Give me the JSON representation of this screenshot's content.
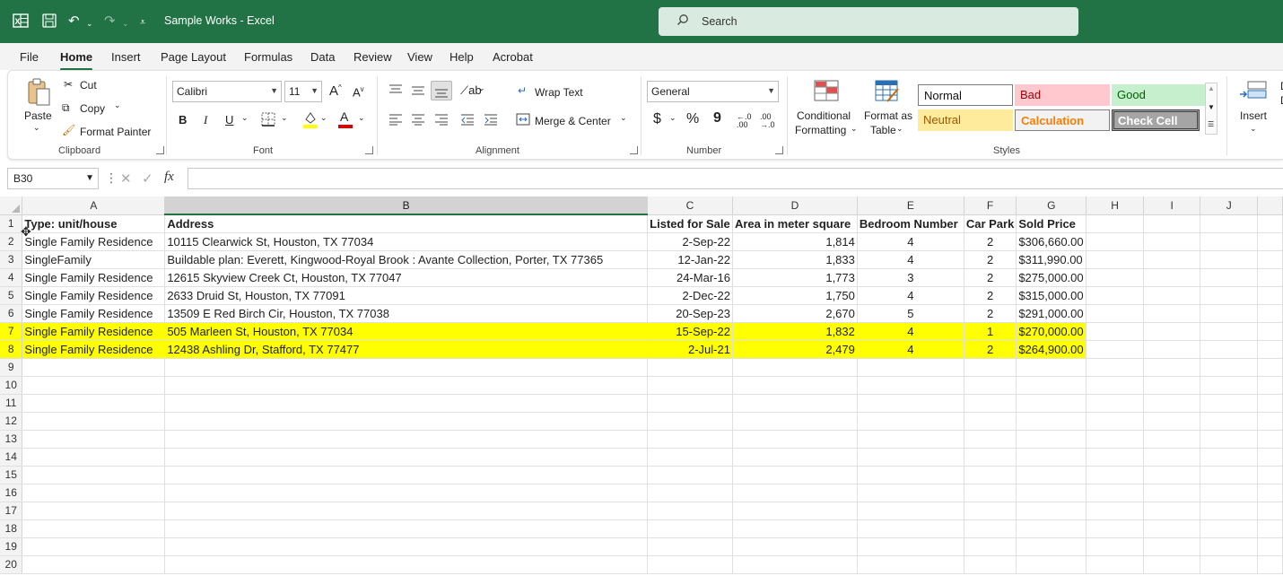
{
  "titlebar": {
    "doc_title": "Sample Works  -  Excel",
    "search_placeholder": "Search"
  },
  "menu": {
    "tabs": [
      "File",
      "Home",
      "Insert",
      "Page Layout",
      "Formulas",
      "Data",
      "Review",
      "View",
      "Help",
      "Acrobat"
    ],
    "active": "Home"
  },
  "ribbon": {
    "clipboard": {
      "paste": "Paste",
      "cut": "Cut",
      "copy": "Copy",
      "format_painter": "Format Painter",
      "label": "Clipboard"
    },
    "font": {
      "name": "Calibri",
      "size": "11",
      "bold": "B",
      "italic": "I",
      "underline": "U",
      "font_color_glyph": "A",
      "grow": "A",
      "shrink": "A",
      "label": "Font"
    },
    "alignment": {
      "wrap_text": "Wrap Text",
      "merge_center": "Merge & Center",
      "label": "Alignment"
    },
    "number": {
      "format": "General",
      "currency": "$",
      "percent": "%",
      "comma": "9",
      "label": "Number"
    },
    "styles": {
      "conditional_formatting_1": "Conditional",
      "conditional_formatting_2": "Formatting",
      "format_table_1": "Format as",
      "format_table_2": "Table",
      "normal": "Normal",
      "bad": "Bad",
      "good": "Good",
      "neutral": "Neutral",
      "calculation": "Calculation",
      "check_cell": "Check Cell",
      "label": "Styles"
    },
    "cells": {
      "insert": "Insert",
      "d1": "D",
      "d2": "D"
    }
  },
  "formula_bar": {
    "name_box": "B30",
    "fx": "fx",
    "formula": ""
  },
  "sheet": {
    "columns": [
      "A",
      "B",
      "C",
      "D",
      "E",
      "F",
      "G",
      "H",
      "I",
      "J"
    ],
    "selected_column": "B",
    "headers": [
      "Type: unit/house",
      "Address",
      "Listed for Sale",
      "Area in meter square",
      "Bedroom Number",
      "Car Park",
      "Sold Price"
    ],
    "rows": [
      [
        "Single Family Residence",
        "10115 Clearwick St, Houston, TX 77034",
        "2-Sep-22",
        "1,814",
        "4",
        "2",
        "$306,660.00"
      ],
      [
        "SingleFamily",
        "Buildable plan: Everett, Kingwood-Royal Brook : Avante Collection, Porter, TX 77365",
        "12-Jan-22",
        "1,833",
        "4",
        "2",
        "$311,990.00"
      ],
      [
        "Single Family Residence",
        "12615 Skyview Creek Ct, Houston, TX 77047",
        "24-Mar-16",
        "1,773",
        "3",
        "2",
        "$275,000.00"
      ],
      [
        "Single Family Residence",
        "2633 Druid St, Houston, TX 77091",
        "2-Dec-22",
        "1,750",
        "4",
        "2",
        "$315,000.00"
      ],
      [
        "Single Family Residence",
        "13509 E Red Birch Cir, Houston, TX 77038",
        "20-Sep-23",
        "2,670",
        "5",
        "2",
        "$291,000.00"
      ],
      [
        "Single Family Residence",
        "505 Marleen St, Houston, TX 77034",
        "15-Sep-22",
        "1,832",
        "4",
        "1",
        "$270,000.00"
      ],
      [
        "Single Family Residence",
        "12438 Ashling Dr, Stafford, TX 77477",
        "2-Jul-21",
        "2,479",
        "4",
        "2",
        "$264,900.00"
      ]
    ],
    "highlighted_rows": [
      7,
      8
    ],
    "highlight_color": "#ffff00",
    "row_numbers": [
      "1",
      "2",
      "3",
      "4",
      "5",
      "6",
      "7",
      "8",
      "9",
      "10",
      "11",
      "12",
      "13",
      "14",
      "15",
      "16",
      "17",
      "18",
      "19",
      "20"
    ]
  },
  "colors": {
    "accent": "#217346"
  }
}
